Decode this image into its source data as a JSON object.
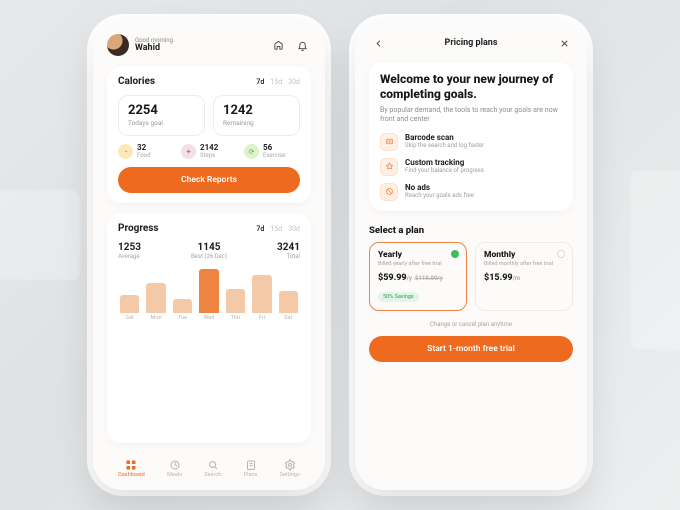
{
  "left": {
    "greeting_small": "Good morning",
    "greeting_name": "Wahid",
    "calories": {
      "title": "Calories",
      "ranges": [
        "7d",
        "15d",
        "30d"
      ],
      "goal_val": "2254",
      "goal_lab": "Todays goal",
      "remain_val": "1242",
      "remain_lab": "Remaining",
      "chips": {
        "food_val": "32",
        "food_lab": "Food",
        "steps_val": "2142",
        "steps_lab": "Steps",
        "ex_val": "56",
        "ex_lab": "Exercise"
      },
      "cta": "Check Reports"
    },
    "progress": {
      "title": "Progress",
      "ranges": [
        "7d",
        "15d",
        "30d"
      ],
      "avg_val": "1253",
      "avg_lab": "Average",
      "best_val": "1145",
      "best_lab": "Best (26 Dec)",
      "total_val": "3241",
      "total_lab": "Total"
    },
    "tabs": [
      "Dashboard",
      "Meals",
      "Search",
      "Plans",
      "Settings"
    ]
  },
  "right": {
    "header": "Pricing plans",
    "welcome_title": "Welcome to your new journey of completing goals.",
    "welcome_sub": "By popular demand, the tools to reach your goals are now front and center",
    "feat1_t": "Barcode scan",
    "feat1_s": "Skip the search and log faster",
    "feat2_t": "Custom tracking",
    "feat2_s": "Find your balance of progress",
    "feat3_t": "No ads",
    "feat3_s": "Reach your goals ads free",
    "select_title": "Select a plan",
    "yearly_name": "Yearly",
    "yearly_bill": "Billed yearly after free trial",
    "yearly_price": "$59.99",
    "yearly_per": "/y",
    "yearly_strike": "$119.99/y",
    "yearly_badge": "50% Savings",
    "monthly_name": "Monthly",
    "monthly_bill": "Billed monthly after free trial",
    "monthly_price": "$15.99",
    "monthly_per": "/m",
    "note": "Change or cancel plan anytime",
    "cta": "Start 1-month free trial"
  },
  "chart_data": {
    "type": "bar",
    "title": "Progress",
    "categories": [
      "Sat",
      "Mon",
      "Tue",
      "Wed",
      "Thu",
      "Fri",
      "Sat"
    ],
    "values": [
      22,
      38,
      18,
      55,
      30,
      48,
      27
    ],
    "highlight_index": 3,
    "ylim": [
      0,
      60
    ],
    "xlabel": "",
    "ylabel": ""
  }
}
